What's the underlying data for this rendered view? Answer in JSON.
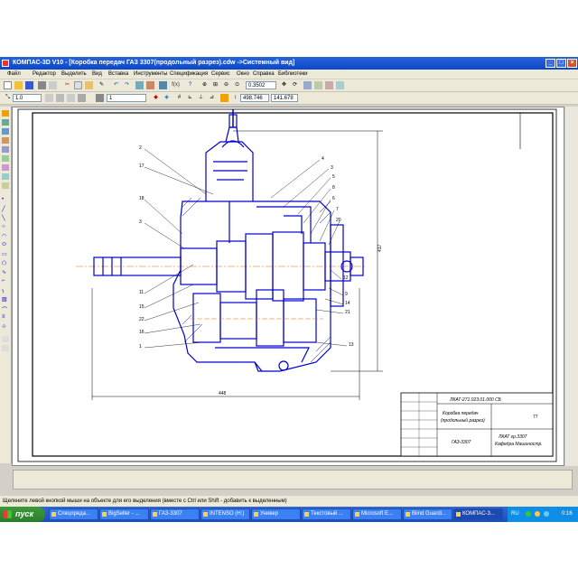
{
  "window": {
    "title": "КОМПАС-3D V10 - [Коробка передач ГАЗ 3307(продольный разрез).cdw ->Системный вид]"
  },
  "menu": [
    "Файл",
    "Редактор",
    "Выделить",
    "Вид",
    "Вставка",
    "Инструменты",
    "Спецификация",
    "Сервис",
    "Окно",
    "Справка",
    "Библиотеки"
  ],
  "toolbar": {
    "zoom_value": "0.3502",
    "scale_value": "1.0",
    "layer_value": "1",
    "coord_x": "498.746",
    "coord_y": "141.678"
  },
  "drawing": {
    "callouts_left": [
      "2",
      "17",
      "18",
      "3",
      "11",
      "15",
      "22",
      "16",
      "1"
    ],
    "callouts_right": [
      "4",
      "3",
      "5",
      "8",
      "6",
      "7",
      "20",
      "12",
      "9",
      "14",
      "21",
      "13"
    ],
    "dim_width": "448",
    "dim_height": "417",
    "stamp": {
      "code": "ЛКАТ-271.023.01.000 СБ",
      "title_line1": "Коробка передач",
      "title_line2": "(продольный разрез)",
      "model": "ГАЗ-3307",
      "sheet": "77",
      "org_line1": "ЛКАТ гр.3307",
      "org_line2": "Кафедра Машиностр."
    }
  },
  "status_text": "Щелкните левой кнопкой мыши на объекте для его выделения (вместе с Ctrl или Shift - добавить к выделенным)",
  "taskbar": {
    "start_label": "пуск",
    "tasks": [
      "Спецпреда...",
      "BigSeller - ...",
      "ГАЗ-3307",
      "INTENSO (H:)",
      "Универ",
      "Текстовый ...",
      "Microsoft E...",
      "Blind Guardi...",
      "КОМПАС-3..."
    ],
    "tray_lang": "RU",
    "clock": "0:16"
  },
  "colors": {
    "drawing_blue": "#0000cc",
    "centerline_orange": "#e07000",
    "titlebar": "#0b48c9"
  }
}
